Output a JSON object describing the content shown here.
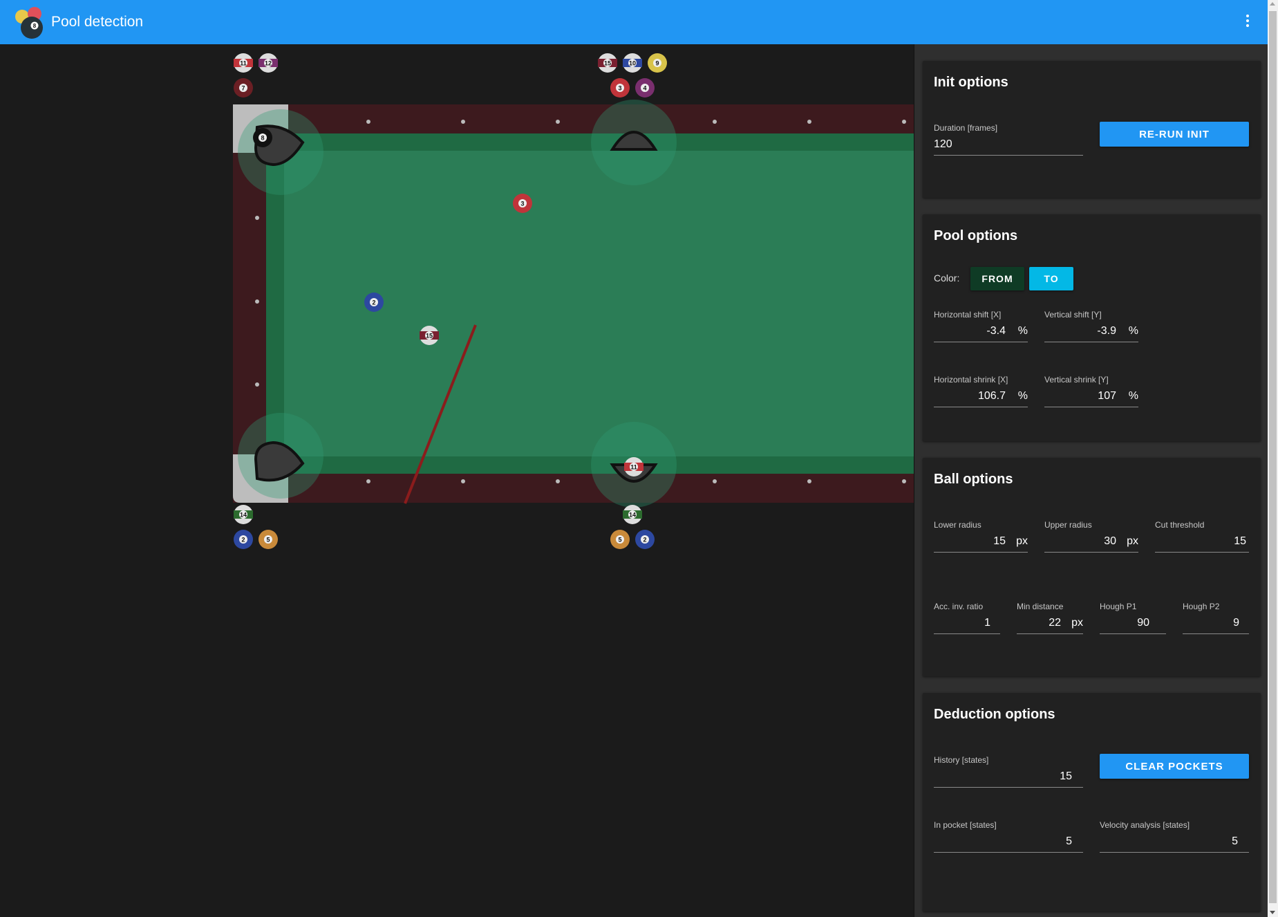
{
  "app": {
    "title": "Pool detection",
    "accent": "#2196f3"
  },
  "init": {
    "title": "Init options",
    "duration_label": "Duration [frames]",
    "duration_value": "120",
    "rerun_label": "RE-RUN INIT"
  },
  "pool": {
    "title": "Pool options",
    "color_label": "Color:",
    "from_label": "FROM",
    "to_label": "TO",
    "from_color": "#0f3b25",
    "to_color": "#03b8e6",
    "hshift_label": "Horizontal shift [X]",
    "hshift_value": "-3.4",
    "vshift_label": "Vertical shift [Y]",
    "vshift_value": "-3.9",
    "hshrink_label": "Horizontal shrink [X]",
    "hshrink_value": "106.7",
    "vshrink_label": "Vertical shrink [Y]",
    "vshrink_value": "107",
    "percent": "%"
  },
  "ball": {
    "title": "Ball options",
    "lower_label": "Lower radius",
    "lower_value": "15",
    "upper_label": "Upper radius",
    "upper_value": "30",
    "cut_label": "Cut threshold",
    "cut_value": "15",
    "acc_label": "Acc. inv. ratio",
    "acc_value": "1",
    "mindist_label": "Min distance",
    "mindist_value": "22",
    "p1_label": "Hough P1",
    "p1_value": "90",
    "p2_label": "Hough P2",
    "p2_value": "9",
    "px": "px"
  },
  "deduction": {
    "title": "Deduction options",
    "history_label": "History [states]",
    "history_value": "15",
    "clear_label": "CLEAR POCKETS",
    "inpocket_label": "In pocket [states]",
    "inpocket_value": "5",
    "velocity_label": "Velocity analysis [states]",
    "velocity_value": "5"
  },
  "table_view": {
    "cloth_color": "#2b7d56",
    "rail_color": "#3d1a1e",
    "balls_on_table": [
      {
        "number": "3",
        "color": "#c0343a"
      },
      {
        "number": "2",
        "color": "#2d48a0"
      },
      {
        "number": "15",
        "color": "#7a2030"
      },
      {
        "number": "8",
        "color": "#111111"
      },
      {
        "number": "11",
        "color": "#c0343a"
      }
    ],
    "pocket_top_left": [
      "11",
      "12",
      "7"
    ],
    "pocket_top_center": [
      "15",
      "10",
      "9",
      "3",
      "4"
    ],
    "pocket_bottom_left": [
      "14",
      "2",
      "5"
    ],
    "pocket_bottom_center": [
      "14",
      "5",
      "2"
    ]
  }
}
